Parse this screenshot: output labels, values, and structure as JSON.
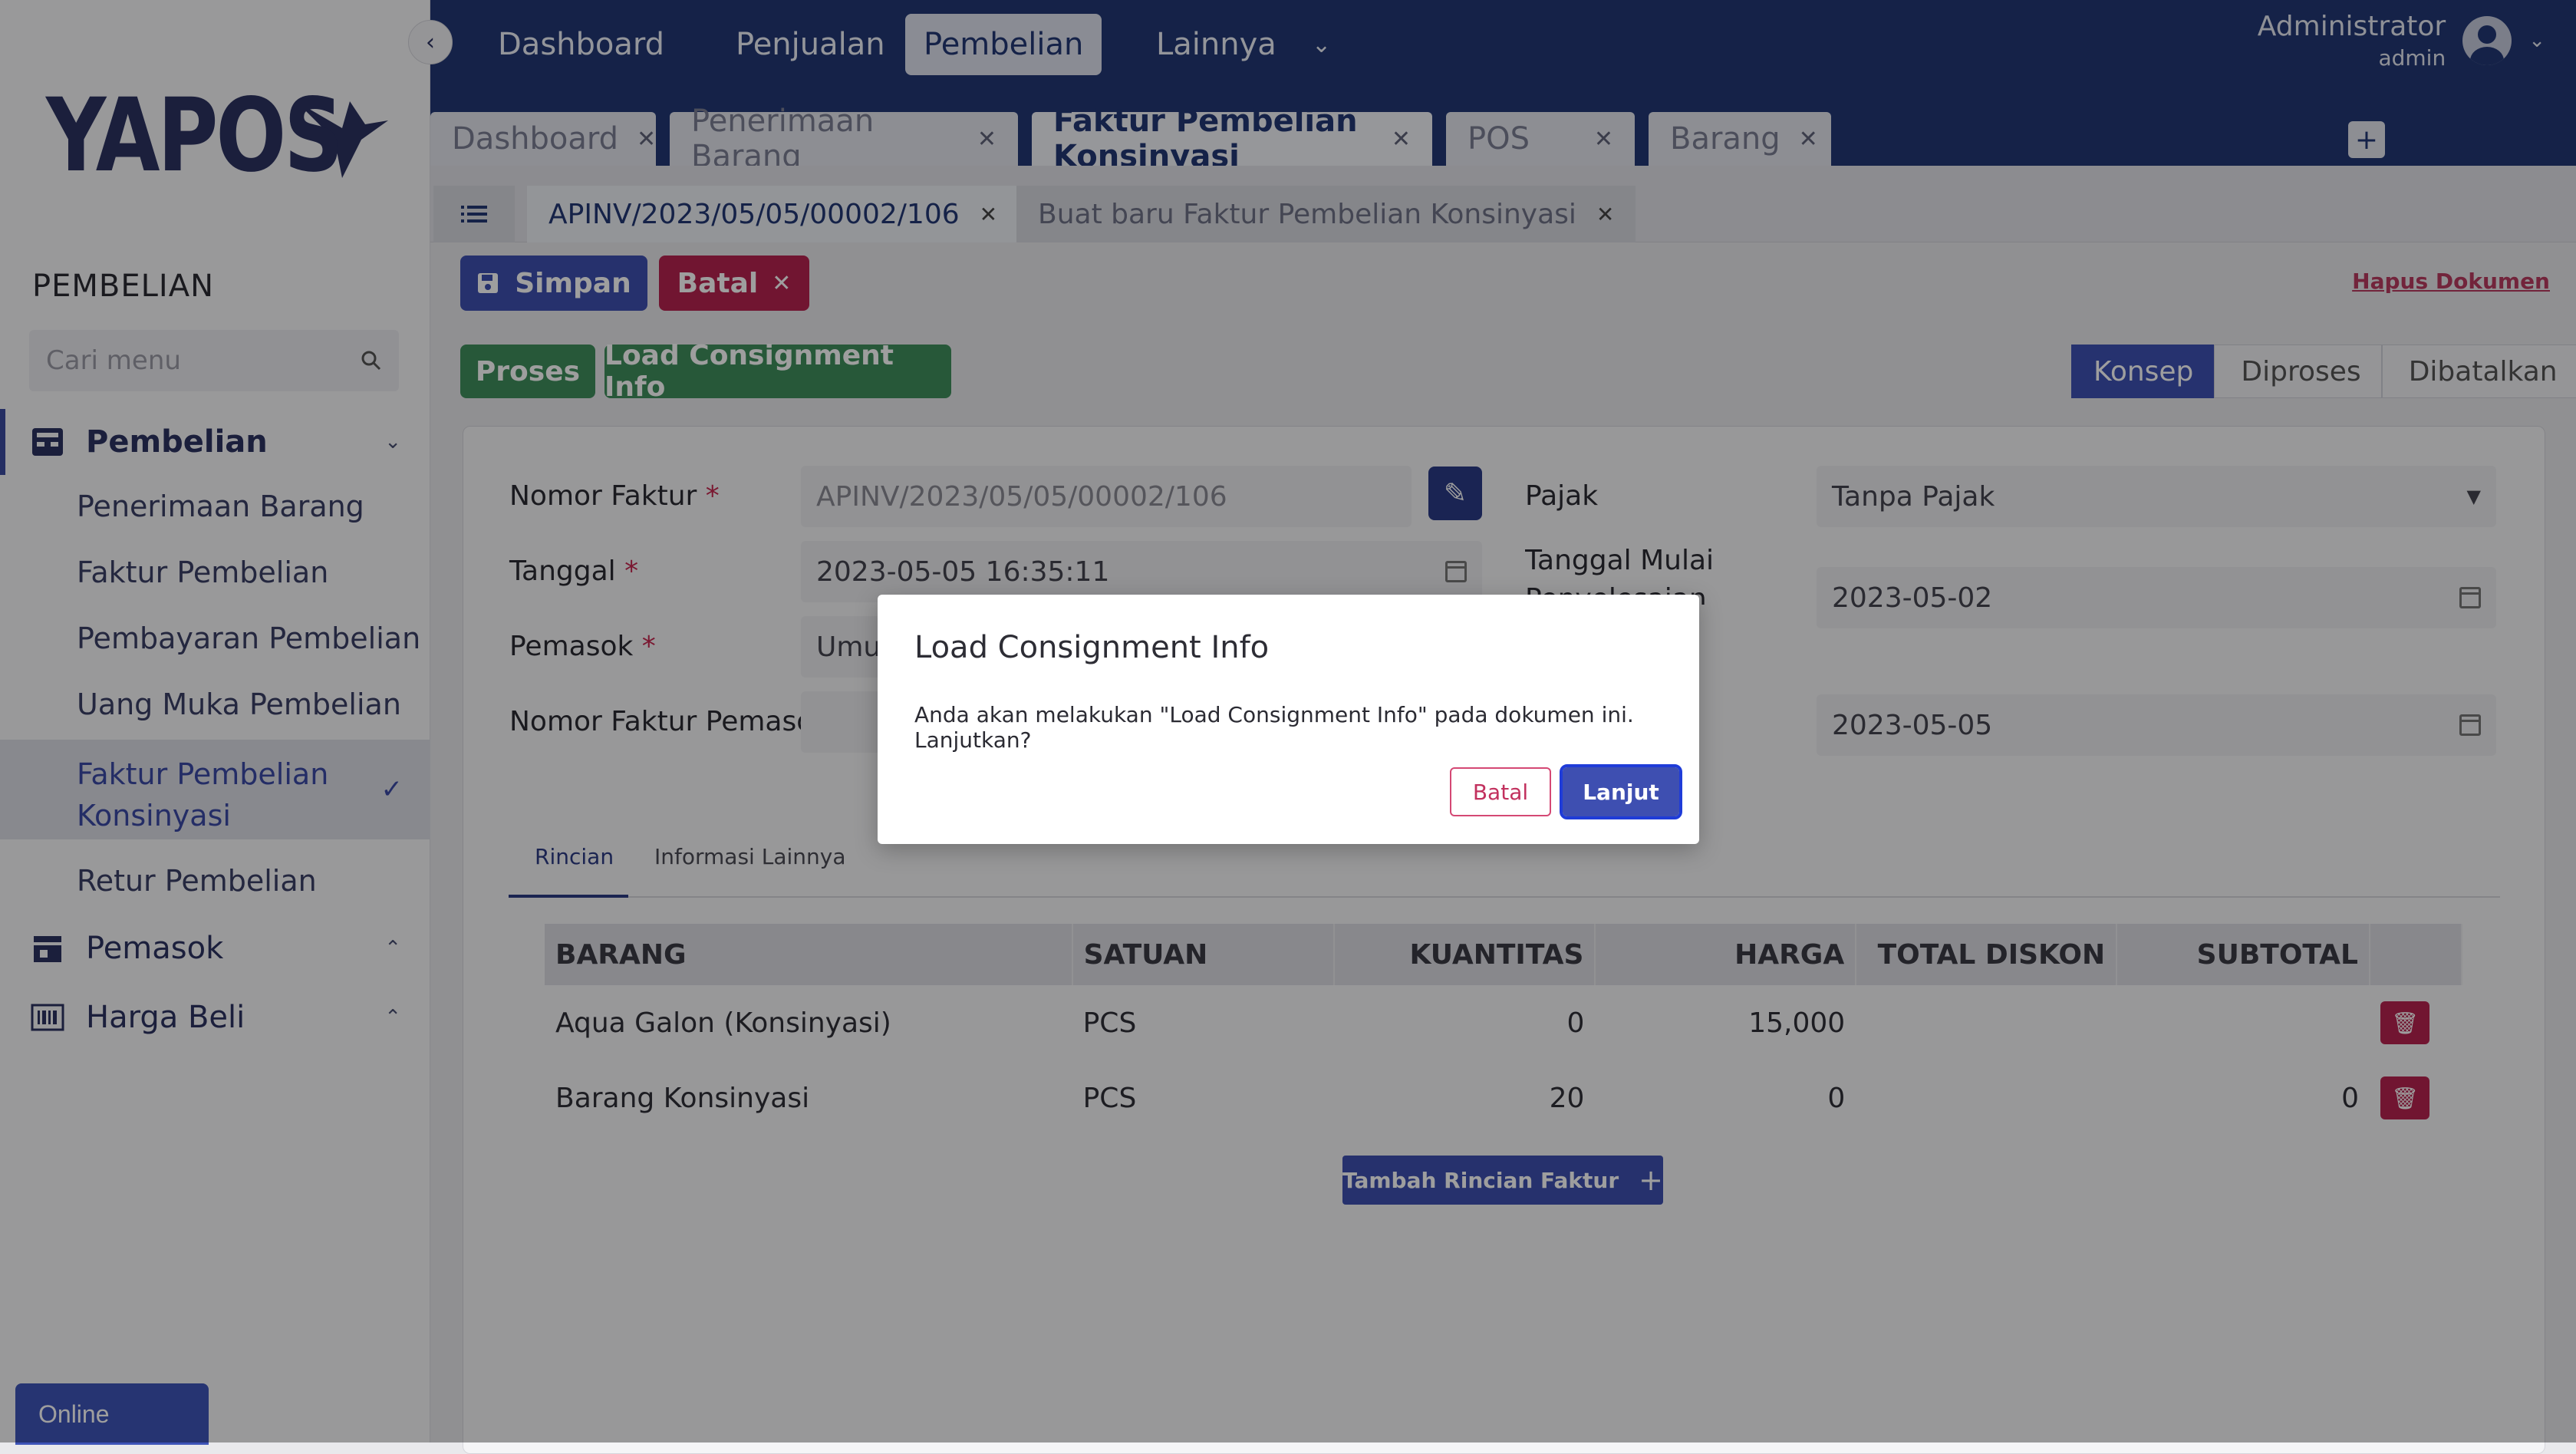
{
  "app": {
    "logo_text": "YAPOS"
  },
  "sidebar": {
    "section_title": "PEMBELIAN",
    "search_placeholder": "Cari menu",
    "groups": [
      {
        "label": "Pembelian",
        "icon": "inbox-icon",
        "expanded": true
      },
      {
        "label": "Pemasok",
        "icon": "store-icon",
        "expanded": false
      },
      {
        "label": "Harga Beli",
        "icon": "barcode-icon",
        "expanded": false
      }
    ],
    "items": [
      {
        "label": "Penerimaan Barang"
      },
      {
        "label": "Faktur Pembelian"
      },
      {
        "label": "Pembayaran Pembelian"
      },
      {
        "label": "Uang Muka Pembelian"
      },
      {
        "label_line1": "Faktur Pembelian",
        "label_line2": "Konsinyasi",
        "selected": true
      },
      {
        "label": "Retur Pembelian"
      }
    ],
    "status": "Online"
  },
  "topnav": {
    "items": [
      "Dashboard",
      "Penjualan",
      "Pembelian",
      "Lainnya"
    ],
    "active": "Pembelian",
    "user_name": "Administrator",
    "user_role": "admin"
  },
  "doc_tabs": [
    "Dashboard",
    "Penerimaan Barang",
    "Faktur Pembelian Konsinyasi",
    "POS",
    "Barang"
  ],
  "sub_tabs": [
    "APINV/2023/05/05/00002/106",
    "Buat baru Faktur Pembelian Konsinyasi"
  ],
  "actions": {
    "save": "Simpan",
    "cancel": "Batal",
    "delete_doc": "Hapus Dokumen",
    "process": "Proses",
    "load_info": "Load Consignment Info"
  },
  "status_steps": [
    "Konsep",
    "Diproses",
    "Dibatalkan"
  ],
  "form": {
    "nomor_faktur_label": "Nomor Faktur",
    "nomor_faktur_value": "APINV/2023/05/05/00002/106",
    "tanggal_label": "Tanggal",
    "tanggal_value": "2023-05-05  16:35:11",
    "pemasok_label": "Pemasok",
    "pemasok_value": "Umu",
    "nomor_faktur_pemasok_label": "Nomor Faktur Pemasok",
    "pajak_label": "Pajak",
    "pajak_value": "Tanpa Pajak",
    "tgl_mulai_label": "Tanggal Mulai",
    "tgl_mulai_label_cut": "Penyelesaian",
    "tgl_mulai_value": "2023-05-02",
    "tgl_akhir_value": "2023-05-05"
  },
  "content_tabs": [
    "Rincian",
    "Informasi Lainnya"
  ],
  "table": {
    "headers": [
      "BARANG",
      "SATUAN",
      "KUANTITAS",
      "HARGA",
      "TOTAL DISKON",
      "SUBTOTAL"
    ],
    "rows": [
      [
        "Aqua Galon (Konsinyasi)",
        "PCS",
        "0",
        "15,000",
        "",
        ""
      ],
      [
        "Barang Konsinyasi",
        "PCS",
        "20",
        "0",
        "",
        "0"
      ]
    ],
    "add_button": "Tambah Rincian Faktur"
  },
  "modal": {
    "title": "Load Consignment Info",
    "message": "Anda akan melakukan \"Load Consignment Info\" pada dokumen ini. Lanjutkan?",
    "cancel": "Batal",
    "confirm": "Lanjut"
  },
  "colors": {
    "primary": "#223774",
    "accent": "#3e52b4",
    "danger": "#b6234f",
    "success": "#3f8f5d"
  }
}
